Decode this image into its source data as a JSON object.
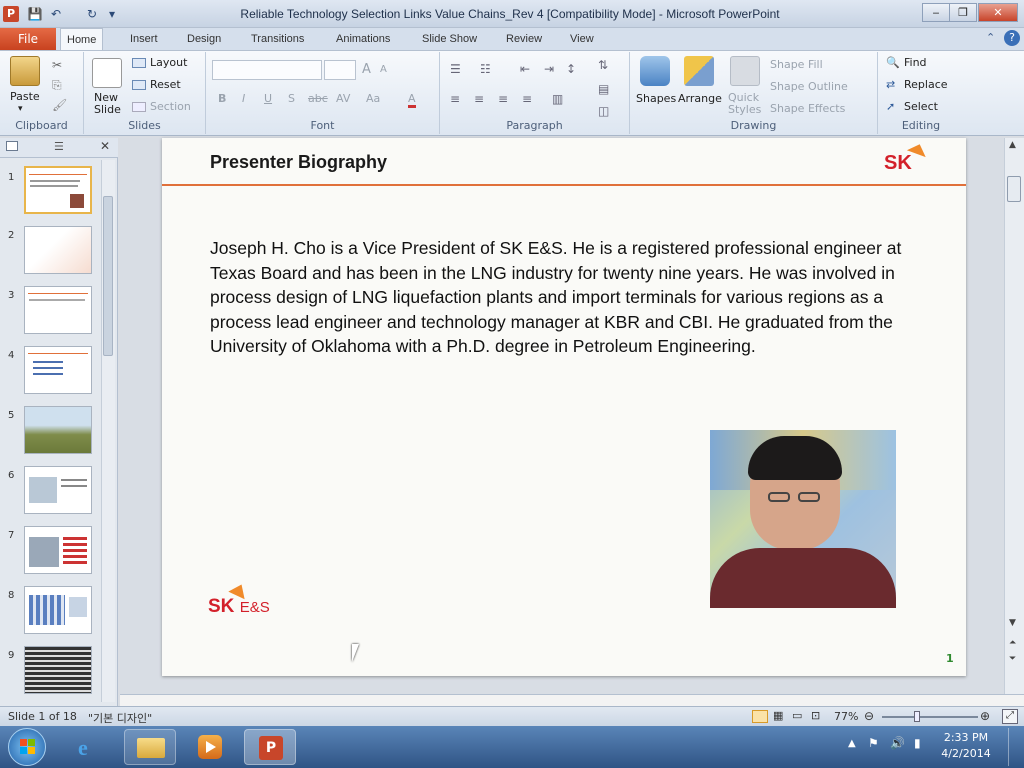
{
  "window": {
    "title": "Reliable Technology Selection Links Value Chains_Rev 4 [Compatibility Mode] - Microsoft PowerPoint",
    "app_letter": "P",
    "minimize": "‒",
    "restore": "❐",
    "close": "✕"
  },
  "tabs": [
    "File",
    "Home",
    "Insert",
    "Design",
    "Transitions",
    "Animations",
    "Slide Show",
    "Review",
    "View"
  ],
  "ribbon": {
    "clipboard": {
      "label": "Clipboard",
      "paste": "Paste"
    },
    "slides": {
      "label": "Slides",
      "new_slide": "New Slide",
      "layout": "Layout",
      "reset": "Reset",
      "section": "Section"
    },
    "font": {
      "label": "Font",
      "bold": "B",
      "italic": "I",
      "underline": "U",
      "shadow": "S",
      "strike": "abc",
      "spacing": "AV",
      "case": "Aa",
      "color": "A",
      "grow": "A",
      "shrink": "A"
    },
    "paragraph": {
      "label": "Paragraph"
    },
    "drawing": {
      "label": "Drawing",
      "shapes": "Shapes",
      "arrange": "Arrange",
      "quick_styles": "Quick Styles",
      "shape_fill": "Shape Fill",
      "shape_outline": "Shape Outline",
      "shape_effects": "Shape Effects"
    },
    "editing": {
      "label": "Editing",
      "find": "Find",
      "replace": "Replace",
      "select": "Select"
    }
  },
  "thumbnails": [
    "1",
    "2",
    "3",
    "4",
    "5",
    "6",
    "7",
    "8",
    "9"
  ],
  "slide": {
    "title": "Presenter Biography",
    "body": "Joseph H. Cho is a Vice President of SK E&S. He is a registered professional engineer at Texas Board and has been in the LNG industry  for twenty nine years. He was involved in process design of  LNG  liquefaction plants and import terminals for various regions as a process lead engineer and technology manager at KBR and CBI. He graduated from the University of Oklahoma with a Ph.D. degree in Petroleum Engineering.",
    "logo_top": "SK",
    "logo_bottom_sk": "SK",
    "logo_bottom_es": "E&S",
    "number": "1"
  },
  "status": {
    "slide_of": "Slide 1 of 18",
    "theme": "\"기본 디자인\"",
    "zoom": "77%"
  },
  "taskbar": {
    "time": "2:33 PM",
    "date": "4/2/2014"
  },
  "colors": {
    "accent": "#e0703a",
    "file_tab": "#c8421f",
    "sk_red": "#d3202a"
  }
}
